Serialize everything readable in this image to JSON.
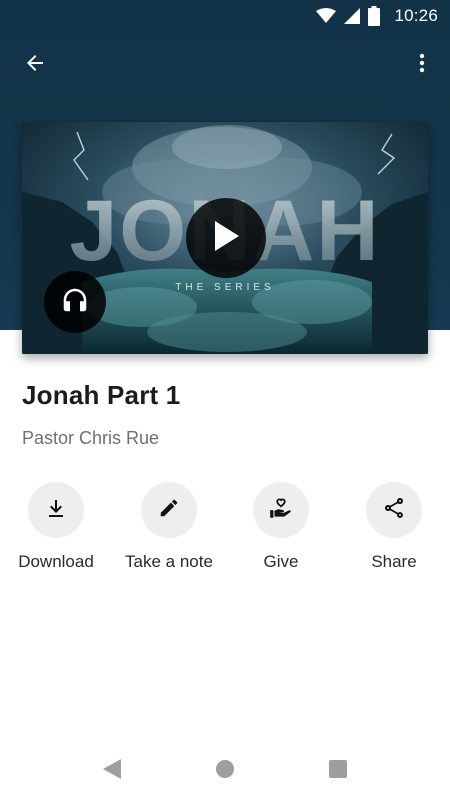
{
  "status_bar": {
    "time": "10:26",
    "icons": [
      "wifi-icon",
      "cell-signal-icon",
      "battery-icon"
    ]
  },
  "app_bar": {
    "back_icon": "arrow-back-icon",
    "more_icon": "more-vert-icon"
  },
  "artwork": {
    "headline": "JONAH",
    "subheadline": "THE SERIES",
    "play_icon": "play-icon",
    "audio_icon": "headphones-icon"
  },
  "message": {
    "title": "Jonah Part 1",
    "speaker": "Pastor Chris Rue"
  },
  "actions": [
    {
      "label": "Download",
      "icon": "download-icon"
    },
    {
      "label": "Take a note",
      "icon": "pencil-icon"
    },
    {
      "label": "Give",
      "icon": "give-heart-hand-icon"
    },
    {
      "label": "Share",
      "icon": "share-icon"
    }
  ],
  "nav_bar": {
    "back_icon": "nav-back-icon",
    "home_icon": "nav-home-icon",
    "recents_icon": "nav-recents-icon"
  },
  "colors": {
    "header": "#15354a",
    "action_circle": "#eeeeee",
    "title_text": "#1c1c1c",
    "subtitle_text": "#707070"
  }
}
